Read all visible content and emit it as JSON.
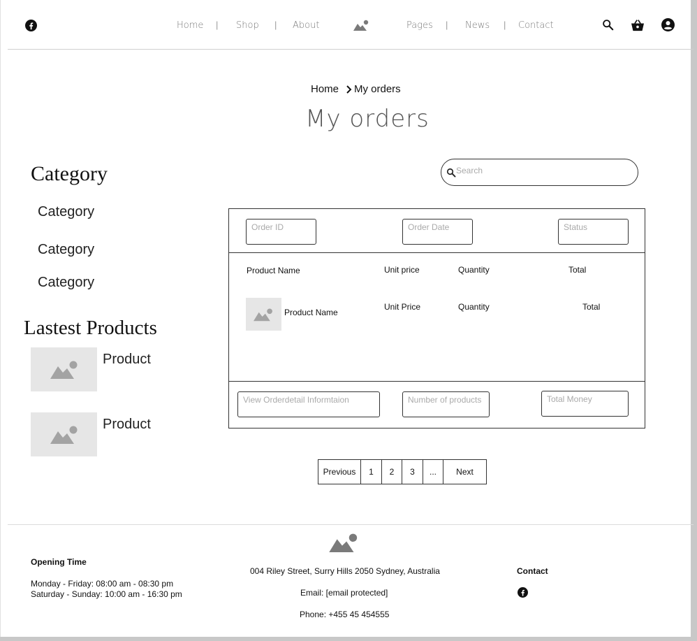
{
  "header": {
    "nav": [
      {
        "label": "Home"
      },
      {
        "label": "Shop"
      },
      {
        "label": "About"
      },
      {
        "label": "Pages"
      },
      {
        "label": "News"
      },
      {
        "label": "Contact"
      }
    ],
    "separator": "|",
    "icons": {
      "left": "facebook-icon",
      "logo": "image-placeholder-icon",
      "search": "search-icon",
      "cart": "basket-icon",
      "account": "account-circle-icon"
    }
  },
  "breadcrumb": {
    "home": "Home",
    "current": "My orders",
    "separator_icon": "chevron-right-icon"
  },
  "page_title": "My orders",
  "sidebar": {
    "category_heading": "Category",
    "categories": [
      "Category",
      "Category",
      "Category"
    ],
    "latest_heading": "Lastest Products",
    "products": [
      {
        "label": "Product"
      },
      {
        "label": "Product"
      }
    ]
  },
  "search": {
    "placeholder": "Search"
  },
  "orders_table": {
    "filters": {
      "order_id": "Order ID",
      "order_date": "Order Date",
      "status": "Status"
    },
    "columns": {
      "product_name": "Product Name",
      "unit_price": "Unit price",
      "quantity": "Quantity",
      "total": "Total"
    },
    "row": {
      "product_name": "Product Name",
      "unit_price": "Unit Price",
      "quantity": "Quantity",
      "total": "Total"
    },
    "summary": {
      "details": "View Orderdetail Informtaion",
      "num_products": "Number of products",
      "total_money": "Total Money"
    }
  },
  "pagination": {
    "previous": "Previous",
    "pages": [
      "1",
      "2",
      "3",
      "..."
    ],
    "next": "Next"
  },
  "footer": {
    "opening_title": "Opening Time",
    "weekday": "Monday - Friday: 08:00 am - 08:30 pm",
    "weekend": "Saturday - Sunday: 10:00 am - 16:30 pm",
    "address": "004 Riley Street, Surry Hills 2050 Sydney, Australia",
    "email": "Email: [email protected]",
    "phone": "Phone: +455 45 454555",
    "contact_title": "Contact"
  },
  "colors": {
    "placeholder_bg": "#e6e6e6",
    "placeholder_fg": "#a3a3a3",
    "nav_text": "#7a7a7a",
    "border": "#333333"
  }
}
